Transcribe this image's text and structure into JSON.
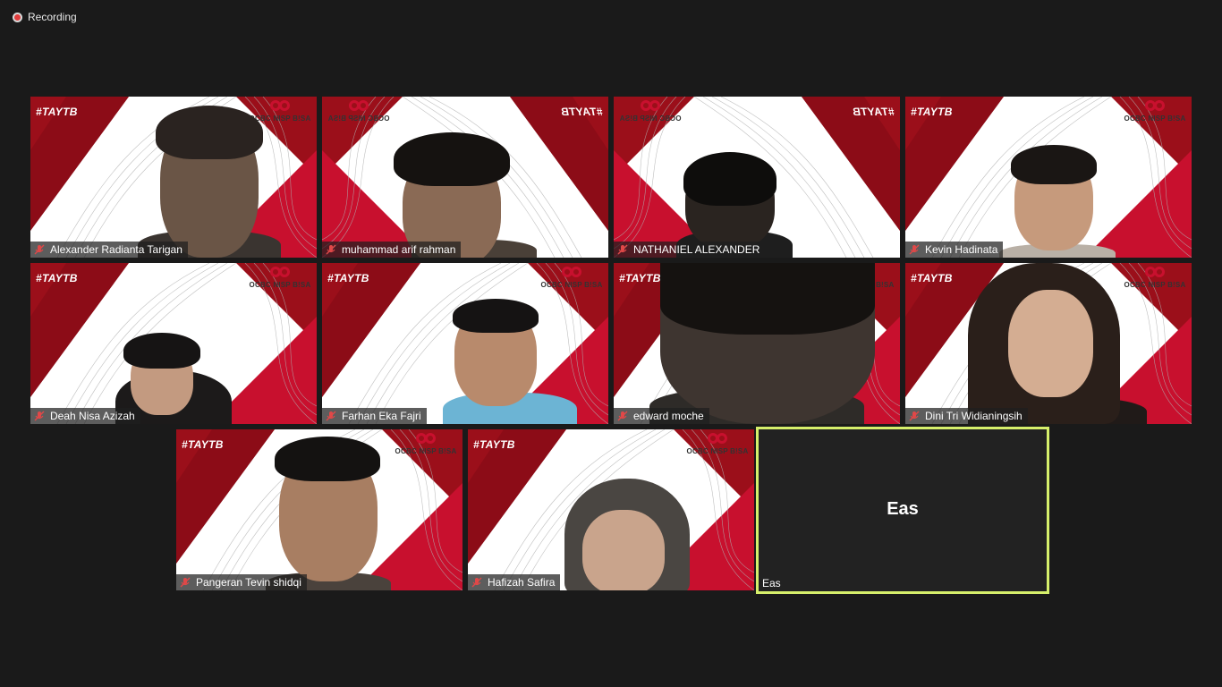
{
  "recording": {
    "label": "Recording"
  },
  "background": {
    "hashtag": "#TAYTB",
    "brand": "OCBC NISP B!SA"
  },
  "participants": [
    {
      "name": "Alexander Radianta Tarigan",
      "muted": true
    },
    {
      "name": "muhammad arif rahman",
      "muted": true
    },
    {
      "name": "NATHANIEL ALEXANDER",
      "muted": true
    },
    {
      "name": "Kevin Hadinata",
      "muted": true
    },
    {
      "name": "Deah Nisa Azizah",
      "muted": true
    },
    {
      "name": "Farhan Eka Fajri",
      "muted": true
    },
    {
      "name": "edward moche",
      "muted": true
    },
    {
      "name": "Dini Tri Widianingsih",
      "muted": true
    },
    {
      "name": "Pangeran Tevin shidqi",
      "muted": true
    },
    {
      "name": "Hafizah Safira",
      "muted": true
    }
  ],
  "self": {
    "display": "Eas",
    "label": "Eas"
  },
  "colors": {
    "brand_red": "#9b0f1a",
    "active_border": "#d6ef6b",
    "background": "#1a1a1a"
  }
}
